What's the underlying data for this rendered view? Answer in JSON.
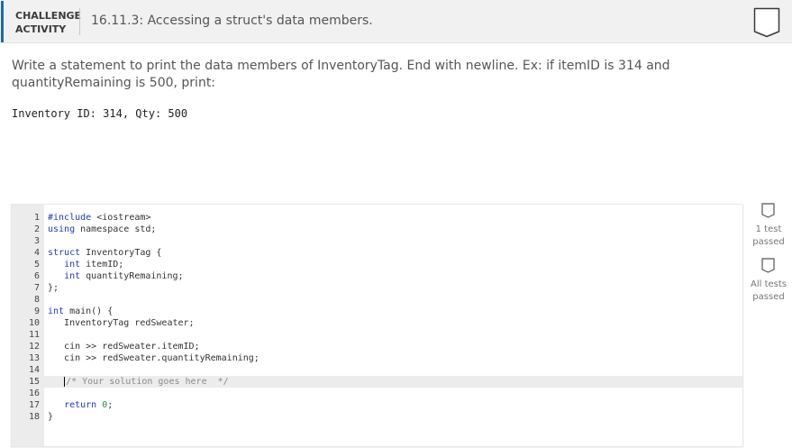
{
  "header": {
    "label_line1": "CHALLENGE",
    "label_line2": "ACTIVITY",
    "title": "16.11.3: Accessing a struct's data members.",
    "accent_color": "#1e6aa6",
    "bookmark_icon": "bookmark-icon"
  },
  "prompt": {
    "text": "Write a statement to print the data members of InventoryTag. End with newline. Ex: if itemID is 314 and quantityRemaining is 500, print:",
    "example_output": "Inventory ID: 314, Qty: 500"
  },
  "editor": {
    "lines": [
      {
        "n": "1",
        "code": "#include <iostream>"
      },
      {
        "n": "2",
        "code": "using namespace std;"
      },
      {
        "n": "3",
        "code": ""
      },
      {
        "n": "4",
        "code": "struct InventoryTag {"
      },
      {
        "n": "5",
        "code": "   int itemID;"
      },
      {
        "n": "6",
        "code": "   int quantityRemaining;"
      },
      {
        "n": "7",
        "code": "};"
      },
      {
        "n": "8",
        "code": ""
      },
      {
        "n": "9",
        "code": "int main() {"
      },
      {
        "n": "10",
        "code": "   InventoryTag redSweater;"
      },
      {
        "n": "11",
        "code": ""
      },
      {
        "n": "12",
        "code": "   cin >> redSweater.itemID;"
      },
      {
        "n": "13",
        "code": "   cin >> redSweater.quantityRemaining;"
      },
      {
        "n": "14",
        "code": ""
      },
      {
        "n": "15",
        "code": "   /* Your solution goes here  */"
      },
      {
        "n": "16",
        "code": ""
      },
      {
        "n": "17",
        "code": "   return 0;"
      },
      {
        "n": "18",
        "code": "}"
      }
    ],
    "active_line": 15
  },
  "status": {
    "test1_line1": "1 test",
    "test1_line2": "passed",
    "test2_line1": "All tests",
    "test2_line2": "passed",
    "checkbox_icon": "checkbox-icon"
  }
}
